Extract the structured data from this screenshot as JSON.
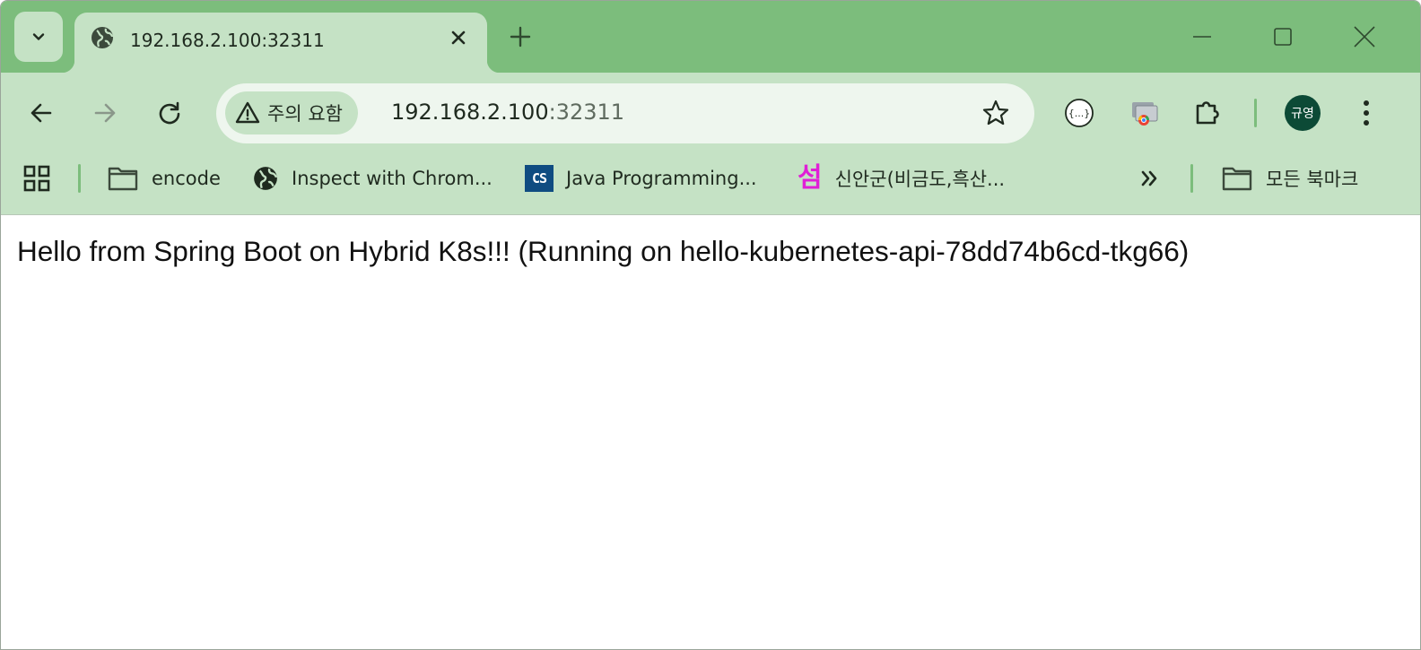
{
  "tab": {
    "title": "192.168.2.100:32311"
  },
  "toolbar": {
    "security_label": "주의 요함",
    "url_host": "192.168.2.100",
    "url_port": ":32311",
    "profile_initials": "규영"
  },
  "bookmarks": {
    "items": [
      {
        "label": "encode",
        "icon": "folder-icon"
      },
      {
        "label": "Inspect with Chrom...",
        "icon": "globe-icon"
      },
      {
        "label": "Java Programming...",
        "icon": "cs-icon",
        "icon_text": "CS"
      },
      {
        "label": "신안군(비금도,흑산...",
        "icon": "seom-icon",
        "icon_text": "섬"
      }
    ],
    "all_bookmarks_label": "모든 북마크"
  },
  "page": {
    "message": "Hello from Spring Boot on Hybrid K8s!!! (Running on hello-kubernetes-api-78dd74b6cd-tkg66)"
  },
  "colors": {
    "frame": "#7cbd7c",
    "toolbar": "#c5e2c5",
    "omnibox": "#eef6ee",
    "avatar": "#0c4a36",
    "bookmark_seom": "#e01fd7",
    "bookmark_cs": "#0f4c81"
  }
}
